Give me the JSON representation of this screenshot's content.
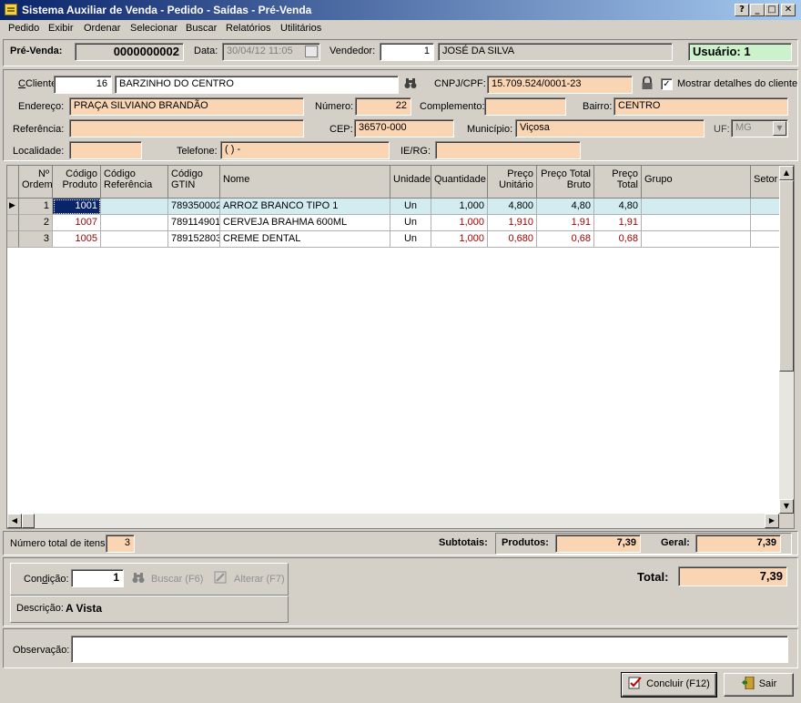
{
  "window": {
    "title": "Sistema Auxiliar de Venda - Pedido - Saídas - Pré-Venda",
    "help": "?",
    "minimize": "_",
    "maximize": "□",
    "close": "✕"
  },
  "menu": [
    "Pedido",
    "Exibir",
    "Ordenar",
    "Selecionar",
    "Buscar",
    "Relatórios",
    "Utilitários"
  ],
  "header": {
    "prevenda_label": "Pré-Venda:",
    "prevenda_value": "0000000002",
    "data_label": "Data:",
    "data_value": "30/04/12 11:05",
    "vendedor_label": "Vendedor:",
    "vendedor_id": "1",
    "vendedor_name": "JOSÉ DA SILVA",
    "usuario": "Usuário: 1"
  },
  "client": {
    "cliente_label": "Cliente:",
    "cliente_id": "16",
    "cliente_name": "BARZINHO DO CENTRO",
    "cnpj_label": "CNPJ/CPF:",
    "cnpj_value": "15.709.524/0001-23",
    "show_details_label": "Mostrar detalhes do cliente",
    "show_details_checked": "✓",
    "endereco_label": "Endereço:",
    "endereco_value": "PRAÇA SILVIANO BRANDÃO",
    "numero_label": "Número:",
    "numero_value": "22",
    "complemento_label": "Complemento:",
    "complemento_value": "",
    "bairro_label": "Bairro:",
    "bairro_value": "CENTRO",
    "referencia_label": "Referência:",
    "referencia_value": "",
    "cep_label": "CEP:",
    "cep_value": "36570-000",
    "municipio_label": "Município:",
    "municipio_value": "Viçosa",
    "uf_label": "UF:",
    "uf_value": "MG",
    "localidade_label": "Localidade:",
    "localidade_value": "",
    "telefone_label": "Telefone:",
    "telefone_value": "( )    -",
    "ierg_label": "IE/RG:",
    "ierg_value": ""
  },
  "grid": {
    "columns": {
      "ordem": "Nº Ordem",
      "codigo_produto": "Código Produto",
      "codigo_referencia": "Código Referência",
      "codigo_gtin": "Código GTIN",
      "nome": "Nome",
      "unidade": "Unidade",
      "quantidade": "Quantidade",
      "preco_unitario": "Preço Unitário",
      "preco_total_bruto": "Preço Total Bruto",
      "preco_total": "Preço Total",
      "grupo": "Grupo",
      "setor": "Setor"
    },
    "rows": [
      {
        "ordem": "1",
        "codigo": "1001",
        "referencia": "",
        "gtin": "789350002",
        "nome": "ARROZ BRANCO TIPO 1",
        "unidade": "Un",
        "quantidade": "1,000",
        "preco_unitario": "4,800",
        "total_bruto": "4,80",
        "total": "4,80",
        "grupo": "",
        "setor": ""
      },
      {
        "ordem": "2",
        "codigo": "1007",
        "referencia": "",
        "gtin": "789114901",
        "nome": "CERVEJA BRAHMA 600ML",
        "unidade": "Un",
        "quantidade": "1,000",
        "preco_unitario": "1,910",
        "total_bruto": "1,91",
        "total": "1,91",
        "grupo": "",
        "setor": ""
      },
      {
        "ordem": "3",
        "codigo": "1005",
        "referencia": "",
        "gtin": "789152803",
        "nome": "CREME DENTAL",
        "unidade": "Un",
        "quantidade": "1,000",
        "preco_unitario": "0,680",
        "total_bruto": "0,68",
        "total": "0,68",
        "grupo": "",
        "setor": ""
      }
    ]
  },
  "summary": {
    "num_itens_label": "Número total de itens:",
    "num_itens_value": "3",
    "subtotais_label": "Subtotais:",
    "produtos_label": "Produtos:",
    "produtos_value": "7,39",
    "geral_label": "Geral:",
    "geral_value": "7,39",
    "total_label": "Total:",
    "total_value": "7,39"
  },
  "payment": {
    "condicao_label": "Condição:",
    "condicao_value": "1",
    "buscar_label": "Buscar (F6)",
    "alterar_label": "Alterar (F7)",
    "descricao_label": "Descrição:",
    "descricao_value": "A Vista"
  },
  "footer": {
    "observacao_label": "Observação:",
    "observacao_value": "",
    "concluir_label": "Concluir (F12)",
    "sair_label": "Sair"
  },
  "colors": {
    "accent": "#0a246a",
    "peach": "#f9d5b4",
    "usuario_bg": "#ccf2cc",
    "selected_row": "#d2ecf0"
  }
}
